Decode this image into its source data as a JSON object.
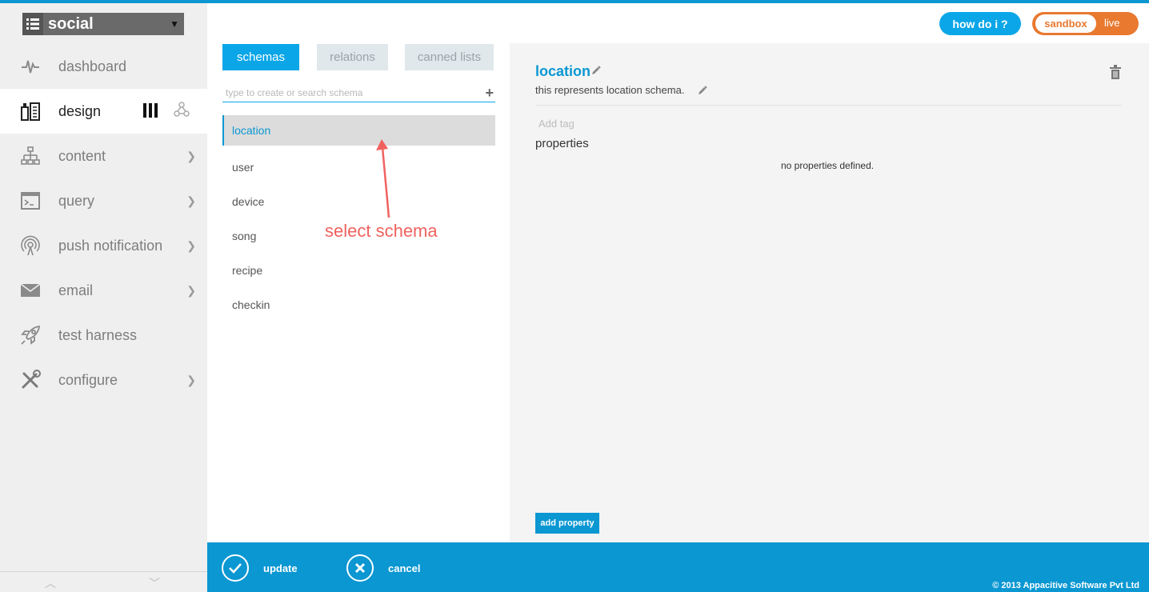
{
  "app_selector": {
    "name": "social"
  },
  "sidebar": {
    "items": [
      {
        "label": "dashboard",
        "icon": "pulse-icon"
      },
      {
        "label": "design",
        "icon": "design-icon"
      },
      {
        "label": "content",
        "icon": "sitemap-icon"
      },
      {
        "label": "query",
        "icon": "terminal-icon"
      },
      {
        "label": "push notification",
        "icon": "broadcast-icon"
      },
      {
        "label": "email",
        "icon": "envelope-icon"
      },
      {
        "label": "test harness",
        "icon": "rocket-icon"
      },
      {
        "label": "configure",
        "icon": "tools-icon"
      }
    ]
  },
  "header": {
    "howdoi_label": "how do i ?",
    "env_sandbox": "sandbox",
    "env_live": "live"
  },
  "tabs": [
    {
      "label": "schemas"
    },
    {
      "label": "relations"
    },
    {
      "label": "canned lists"
    }
  ],
  "search": {
    "placeholder": "type to create or search schema"
  },
  "schemas": [
    {
      "name": "location"
    },
    {
      "name": "user"
    },
    {
      "name": "device"
    },
    {
      "name": "song"
    },
    {
      "name": "recipe"
    },
    {
      "name": "checkin"
    }
  ],
  "annotation": {
    "text": "select schema"
  },
  "detail": {
    "title": "location",
    "description": "this represents location schema.",
    "add_tag": "Add tag",
    "properties_heading": "properties",
    "no_properties": "no properties defined.",
    "add_property_label": "add property"
  },
  "footer": {
    "update_label": "update",
    "cancel_label": "cancel",
    "copyright": "© 2013 Appacitive Software Pvt Ltd"
  },
  "colors": {
    "accent": "#0a97d2",
    "orange": "#e8792f",
    "annotation": "#f0625f"
  }
}
